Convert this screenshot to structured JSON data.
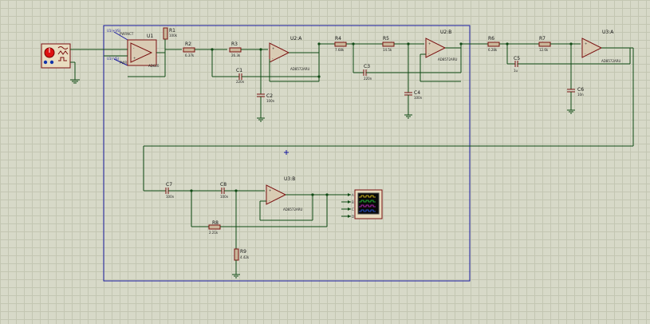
{
  "components": {
    "U1": {
      "ref": "U1",
      "part": "AD620"
    },
    "U2A": {
      "ref": "U2:A",
      "part": "AD8572ARU"
    },
    "U2B": {
      "ref": "U2:B",
      "part": "AD8572ARU"
    },
    "U3A": {
      "ref": "U3:A",
      "part": "AD8572ARU"
    },
    "U3B": {
      "ref": "U3:B",
      "part": "AD8572ARU"
    },
    "R1": {
      "ref": "R1",
      "value": "100k"
    },
    "R2": {
      "ref": "R2",
      "value": "6.37k"
    },
    "R3": {
      "ref": "R3",
      "value": "26.3k"
    },
    "R4": {
      "ref": "R4",
      "value": "7.68k"
    },
    "R5": {
      "ref": "R5",
      "value": "14.5k"
    },
    "R6": {
      "ref": "R6",
      "value": "6.28k"
    },
    "R7": {
      "ref": "R7",
      "value": "12.6k"
    },
    "R8": {
      "ref": "R8",
      "value": "2.21k"
    },
    "R9": {
      "ref": "R9",
      "value": "4.42k"
    },
    "C1": {
      "ref": "C1",
      "value": "220n"
    },
    "C2": {
      "ref": "C2",
      "value": "100n"
    },
    "C3": {
      "ref": "C3",
      "value": "220n"
    },
    "C4": {
      "ref": "C4",
      "value": "100n"
    },
    "C5": {
      "ref": "C5",
      "value": "1u"
    },
    "C6": {
      "ref": "C6",
      "value": "10n"
    },
    "C7": {
      "ref": "C7",
      "value": "100n"
    },
    "C8": {
      "ref": "C8",
      "value": "100n"
    }
  },
  "source_labels": {
    "top": "U1(+VS)",
    "bottom": "U1(-VS)"
  },
  "oscilloscope": {
    "channels": [
      "A",
      "B",
      "C",
      "D"
    ]
  },
  "colors": {
    "wire": "#0f4a14",
    "component": "#7a1010",
    "frame": "#1a1aa0",
    "grid": "#c3c6b2",
    "background": "#d7d9c8"
  }
}
